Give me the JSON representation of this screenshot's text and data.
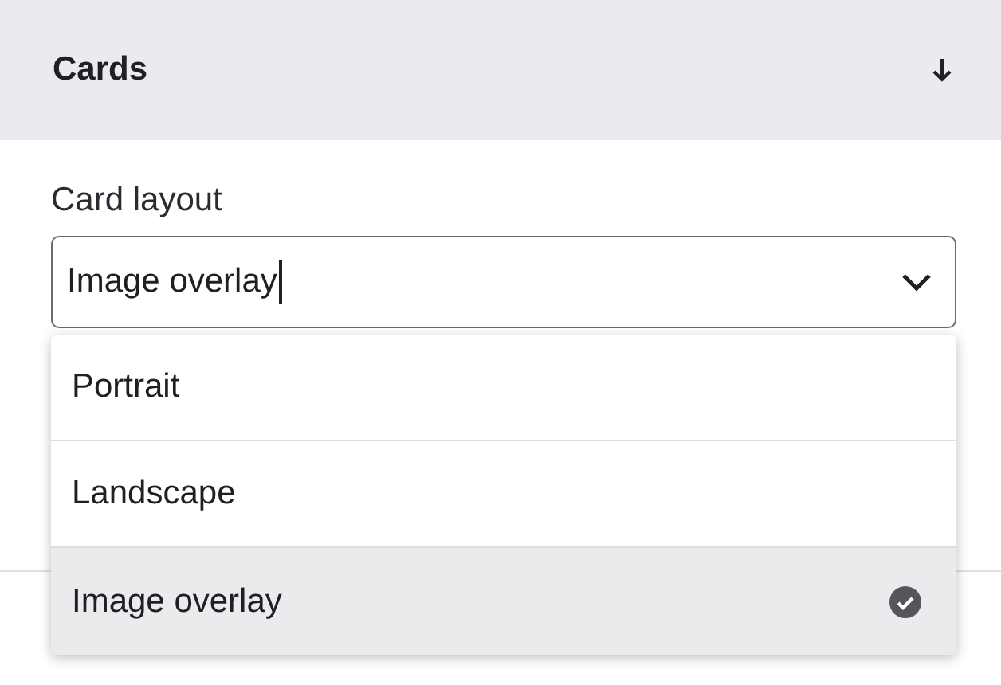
{
  "panel": {
    "title": "Cards"
  },
  "field": {
    "label": "Card layout",
    "value": "Image overlay",
    "open": true
  },
  "options": [
    {
      "label": "Portrait",
      "selected": false
    },
    {
      "label": "Landscape",
      "selected": false
    },
    {
      "label": "Image overlay",
      "selected": true
    }
  ]
}
